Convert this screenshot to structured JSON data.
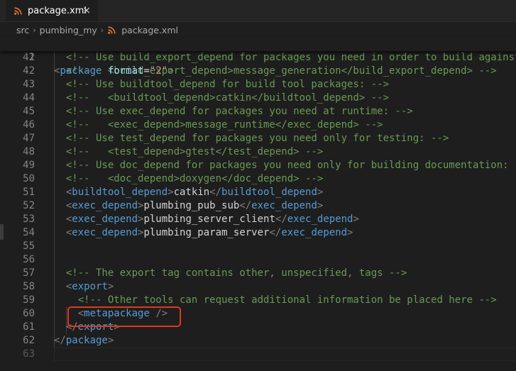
{
  "tab": {
    "label": "package.xml",
    "close": "×",
    "icon": "rss-icon",
    "icon_color": "#e37933"
  },
  "breadcrumb": {
    "items": [
      "src",
      "pumbing_my",
      "package.xml"
    ],
    "separator": "›"
  },
  "colors": {
    "comment": "#6a9955",
    "tag": "#569cd6",
    "bracket": "#808080",
    "attr": "#9cdcfe",
    "string": "#ce9178",
    "text": "#d4d4d4",
    "line_number": "#858585",
    "highlight_box": "#e0381c"
  },
  "sticky_line": {
    "number": "2",
    "tokens": [
      {
        "t": "br",
        "v": "<"
      },
      {
        "t": "tag",
        "v": "package"
      },
      {
        "t": "txt",
        "v": " "
      },
      {
        "t": "attr",
        "v": "format"
      },
      {
        "t": "txt",
        "v": "="
      },
      {
        "t": "str",
        "v": "\"2\""
      },
      {
        "t": "br",
        "v": ">"
      }
    ]
  },
  "lines": [
    {
      "n": "41",
      "tokens": [
        {
          "t": "com",
          "v": "  <!-- Use build_export_depend for packages you need in order to build against"
        }
      ]
    },
    {
      "n": "42",
      "tokens": [
        {
          "t": "com",
          "v": "  <!--   <build_export_depend>message_generation</build_export_depend> -->"
        }
      ]
    },
    {
      "n": "43",
      "tokens": [
        {
          "t": "com",
          "v": "  <!-- Use buildtool_depend for build tool packages: -->"
        }
      ]
    },
    {
      "n": "44",
      "tokens": [
        {
          "t": "com",
          "v": "  <!--   <buildtool_depend>catkin</buildtool_depend> -->"
        }
      ]
    },
    {
      "n": "45",
      "tokens": [
        {
          "t": "com",
          "v": "  <!-- Use exec_depend for packages you need at runtime: -->"
        }
      ]
    },
    {
      "n": "46",
      "tokens": [
        {
          "t": "com",
          "v": "  <!--   <exec_depend>message_runtime</exec_depend> -->"
        }
      ]
    },
    {
      "n": "47",
      "tokens": [
        {
          "t": "com",
          "v": "  <!-- Use test_depend for packages you need only for testing: -->"
        }
      ]
    },
    {
      "n": "48",
      "tokens": [
        {
          "t": "com",
          "v": "  <!--   <test_depend>gtest</test_depend> -->"
        }
      ]
    },
    {
      "n": "49",
      "tokens": [
        {
          "t": "com",
          "v": "  <!-- Use doc_depend for packages you need only for building documentation: -->"
        }
      ]
    },
    {
      "n": "50",
      "tokens": [
        {
          "t": "com",
          "v": "  <!--   <doc_depend>doxygen</doc_depend> -->"
        }
      ]
    },
    {
      "n": "51",
      "tokens": [
        {
          "t": "txt",
          "v": "  "
        },
        {
          "t": "br",
          "v": "<"
        },
        {
          "t": "tag",
          "v": "buildtool_depend"
        },
        {
          "t": "br",
          "v": ">"
        },
        {
          "t": "txt",
          "v": "catkin"
        },
        {
          "t": "br",
          "v": "</"
        },
        {
          "t": "tag",
          "v": "buildtool_depend"
        },
        {
          "t": "br",
          "v": ">"
        }
      ]
    },
    {
      "n": "52",
      "tokens": [
        {
          "t": "txt",
          "v": "  "
        },
        {
          "t": "br",
          "v": "<"
        },
        {
          "t": "tag",
          "v": "exec_depend"
        },
        {
          "t": "br",
          "v": ">"
        },
        {
          "t": "txt",
          "v": "plumbing_pub_sub"
        },
        {
          "t": "br",
          "v": "</"
        },
        {
          "t": "tag",
          "v": "exec_depend"
        },
        {
          "t": "br",
          "v": ">"
        }
      ]
    },
    {
      "n": "53",
      "tokens": [
        {
          "t": "txt",
          "v": "  "
        },
        {
          "t": "br",
          "v": "<"
        },
        {
          "t": "tag",
          "v": "exec_depend"
        },
        {
          "t": "br",
          "v": ">"
        },
        {
          "t": "txt",
          "v": "plumbing_server_client"
        },
        {
          "t": "br",
          "v": "</"
        },
        {
          "t": "tag",
          "v": "exec_depend"
        },
        {
          "t": "br",
          "v": ">"
        }
      ]
    },
    {
      "n": "54",
      "tokens": [
        {
          "t": "txt",
          "v": "  "
        },
        {
          "t": "br",
          "v": "<"
        },
        {
          "t": "tag",
          "v": "exec_depend"
        },
        {
          "t": "br",
          "v": ">"
        },
        {
          "t": "txt",
          "v": "plumbing_param_server"
        },
        {
          "t": "br",
          "v": "</"
        },
        {
          "t": "tag",
          "v": "exec_depend"
        },
        {
          "t": "br",
          "v": ">"
        }
      ]
    },
    {
      "n": "55",
      "tokens": []
    },
    {
      "n": "56",
      "tokens": []
    },
    {
      "n": "57",
      "tokens": [
        {
          "t": "com",
          "v": "  <!-- The export tag contains other, unspecified, tags -->"
        }
      ]
    },
    {
      "n": "58",
      "tokens": [
        {
          "t": "txt",
          "v": "  "
        },
        {
          "t": "br",
          "v": "<"
        },
        {
          "t": "tag",
          "v": "export"
        },
        {
          "t": "br",
          "v": ">"
        }
      ]
    },
    {
      "n": "59",
      "tokens": [
        {
          "t": "com",
          "v": "    <!-- Other tools can request additional information be placed here -->"
        }
      ]
    },
    {
      "n": "60",
      "tokens": [
        {
          "t": "txt",
          "v": "    "
        },
        {
          "t": "br",
          "v": "<"
        },
        {
          "t": "tag",
          "v": "metapackage"
        },
        {
          "t": "txt",
          "v": " "
        },
        {
          "t": "br",
          "v": "/>"
        }
      ]
    },
    {
      "n": "61",
      "tokens": [
        {
          "t": "txt",
          "v": "  "
        },
        {
          "t": "br",
          "v": "</"
        },
        {
          "t": "tag",
          "v": "export"
        },
        {
          "t": "br",
          "v": ">"
        }
      ]
    },
    {
      "n": "62",
      "tokens": [
        {
          "t": "br",
          "v": "</"
        },
        {
          "t": "tag",
          "v": "package"
        },
        {
          "t": "br",
          "v": ">"
        }
      ]
    },
    {
      "n": "63",
      "tokens": []
    }
  ]
}
